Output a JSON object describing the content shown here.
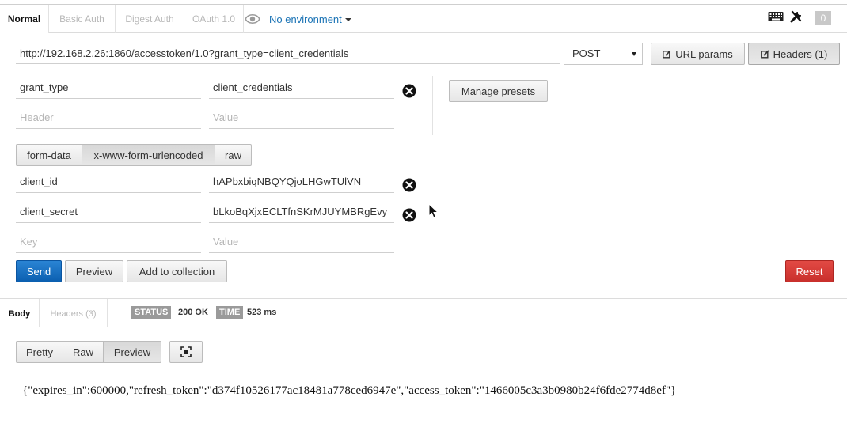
{
  "auth_tabs": [
    {
      "label": "Normal",
      "active": true
    },
    {
      "label": "Basic Auth",
      "active": false
    },
    {
      "label": "Digest Auth",
      "active": false
    },
    {
      "label": "OAuth 1.0",
      "active": false
    }
  ],
  "environment": {
    "label": "No environment"
  },
  "toolbar_counter": "0",
  "request": {
    "url": "http://192.168.2.26:1860/accesstoken/1.0?grant_type=client_credentials",
    "method": "POST",
    "url_params_label": "URL params",
    "headers_label": "Headers (1)"
  },
  "headers": {
    "rows": [
      {
        "key": "grant_type",
        "value": "client_credentials"
      }
    ],
    "key_placeholder": "Header",
    "value_placeholder": "Value",
    "manage_presets_label": "Manage presets"
  },
  "body_modes": [
    {
      "label": "form-data",
      "active": false
    },
    {
      "label": "x-www-form-urlencoded",
      "active": true
    },
    {
      "label": "raw",
      "active": false
    }
  ],
  "form": {
    "rows": [
      {
        "key": "client_id",
        "value": "hAPbxbiqNBQYQjoLHGwTUlVN"
      },
      {
        "key": "client_secret",
        "value": "bLkoBqXjxECLTfnSKrMJUYMBRgEvy"
      }
    ],
    "key_placeholder": "Key",
    "value_placeholder": "Value"
  },
  "actions": {
    "send": "Send",
    "preview": "Preview",
    "add_to_collection": "Add to collection",
    "reset": "Reset"
  },
  "response": {
    "tabs": [
      {
        "label": "Body",
        "active": true
      },
      {
        "label": "Headers (3)",
        "active": false
      }
    ],
    "status_tag": "STATUS",
    "status_value": "200 OK",
    "time_tag": "TIME",
    "time_value": "523 ms",
    "view_modes": [
      {
        "label": "Pretty",
        "active": false
      },
      {
        "label": "Raw",
        "active": false
      },
      {
        "label": "Preview",
        "active": true
      }
    ],
    "body": "{\"expires_in\":600000,\"refresh_token\":\"d374f10526177ac18481a778ced6947e\",\"access_token\":\"1466005c3a3b0980b24f6fde2774d8ef\"}"
  },
  "icons": {
    "environment": "eye-icon",
    "keyboard": "keyboard-icon",
    "settings": "wrench-icon",
    "delete": "delete-circle-icon",
    "edit": "edit-icon",
    "fullscreen": "fullscreen-icon"
  },
  "colors": {
    "send": "#0b5fb0",
    "reset": "#c9302c",
    "link": "#1a73b5",
    "tag": "#9a9a9a"
  }
}
